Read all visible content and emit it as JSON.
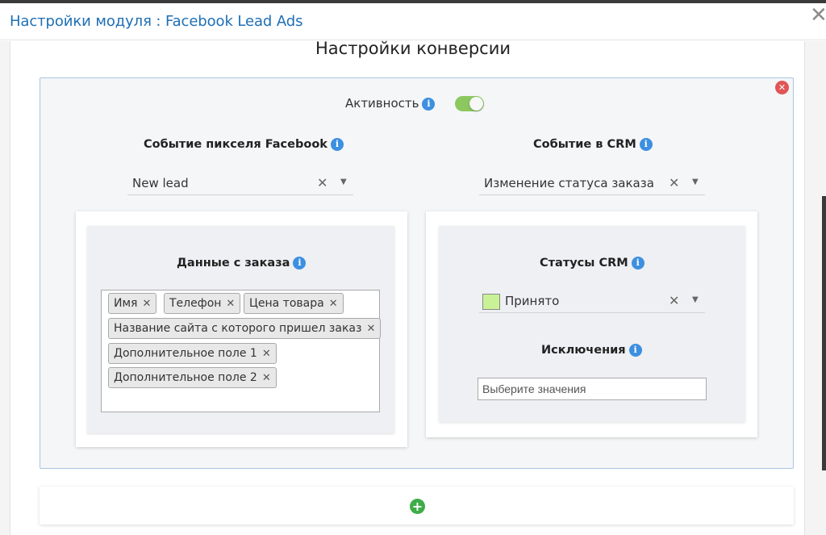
{
  "modal": {
    "title": "Настройки модуля : Facebook Lead Ads",
    "close_glyph": "✕"
  },
  "section": {
    "title": "Настройки конверсии"
  },
  "conversion": {
    "activity_label": "Активность",
    "activity_enabled": true,
    "pixel_event": {
      "label": "Событие пикселя Facebook",
      "value": "New lead"
    },
    "crm_event": {
      "label": "Событие в CRM",
      "value": "Изменение статуса заказа"
    },
    "order_data": {
      "label": "Данные с заказа",
      "tags": [
        "Имя",
        "Телефон",
        "Цена товара",
        "Название сайта с которого пришел заказ",
        "Дополнительное поле 1",
        "Дополнительное поле 2"
      ]
    },
    "crm_statuses": {
      "label": "Статусы CRM",
      "value": "Принято",
      "swatch_color": "#c9f297"
    },
    "exclusions": {
      "label": "Исключения",
      "placeholder": "Выберите значения"
    }
  },
  "icons": {
    "info": "info-icon",
    "remove": "remove-circle-icon",
    "add": "add-circle-icon"
  },
  "colors": {
    "title_blue": "#1e6fb5",
    "toggle_on": "#8cc85f",
    "remove_red": "#e05555",
    "add_green": "#3fad47",
    "info_blue": "#3d8fe0"
  }
}
